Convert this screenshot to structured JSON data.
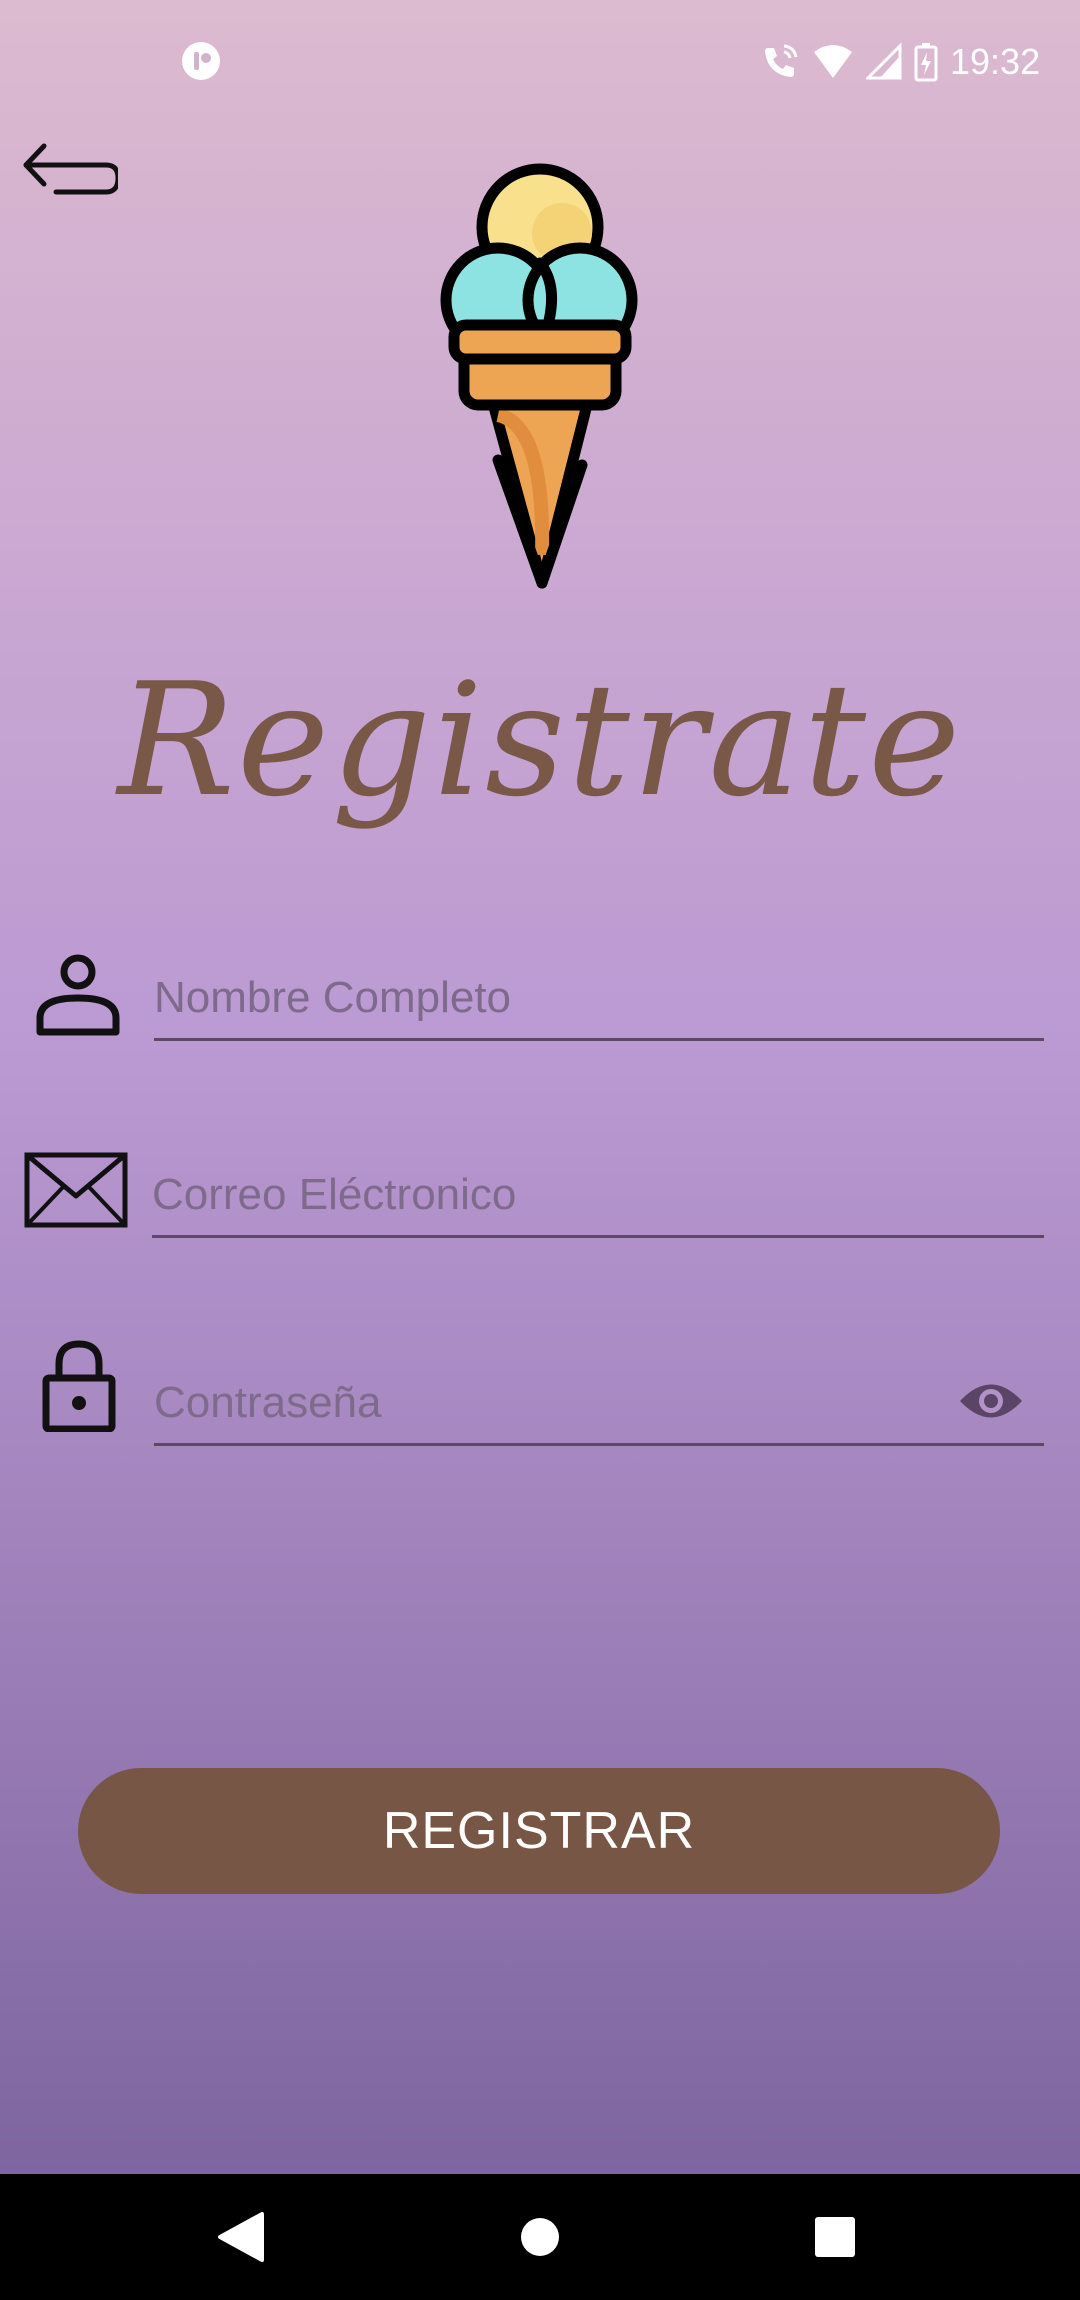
{
  "status_bar": {
    "time": "19:32",
    "icons": [
      "app-notification-icon",
      "wifi-calling-icon",
      "wifi-icon",
      "cellular-signal-icon",
      "battery-charging-icon"
    ]
  },
  "header": {
    "back_icon": "back-arrow-icon",
    "logo_icon": "ice-cream-cone-icon"
  },
  "title": "Registrate",
  "form": {
    "name": {
      "placeholder": "Nombre Completo",
      "value": "",
      "icon": "person-icon"
    },
    "email": {
      "placeholder": "Correo Eléctronico",
      "value": "",
      "icon": "envelope-icon"
    },
    "password": {
      "placeholder": "Contraseña",
      "value": "",
      "icon": "lock-icon",
      "toggle_icon": "eye-icon"
    }
  },
  "submit_label": "REGISTRAR",
  "nav_bar": {
    "icons": [
      "nav-back-icon",
      "nav-home-icon",
      "nav-recents-icon"
    ]
  },
  "colors": {
    "gradient_top": "#dcbad0",
    "gradient_mid": "#bb99d3",
    "gradient_bottom": "#7d65a0",
    "title": "#7a5848",
    "button": "#785646",
    "button_text": "#ffffff"
  }
}
